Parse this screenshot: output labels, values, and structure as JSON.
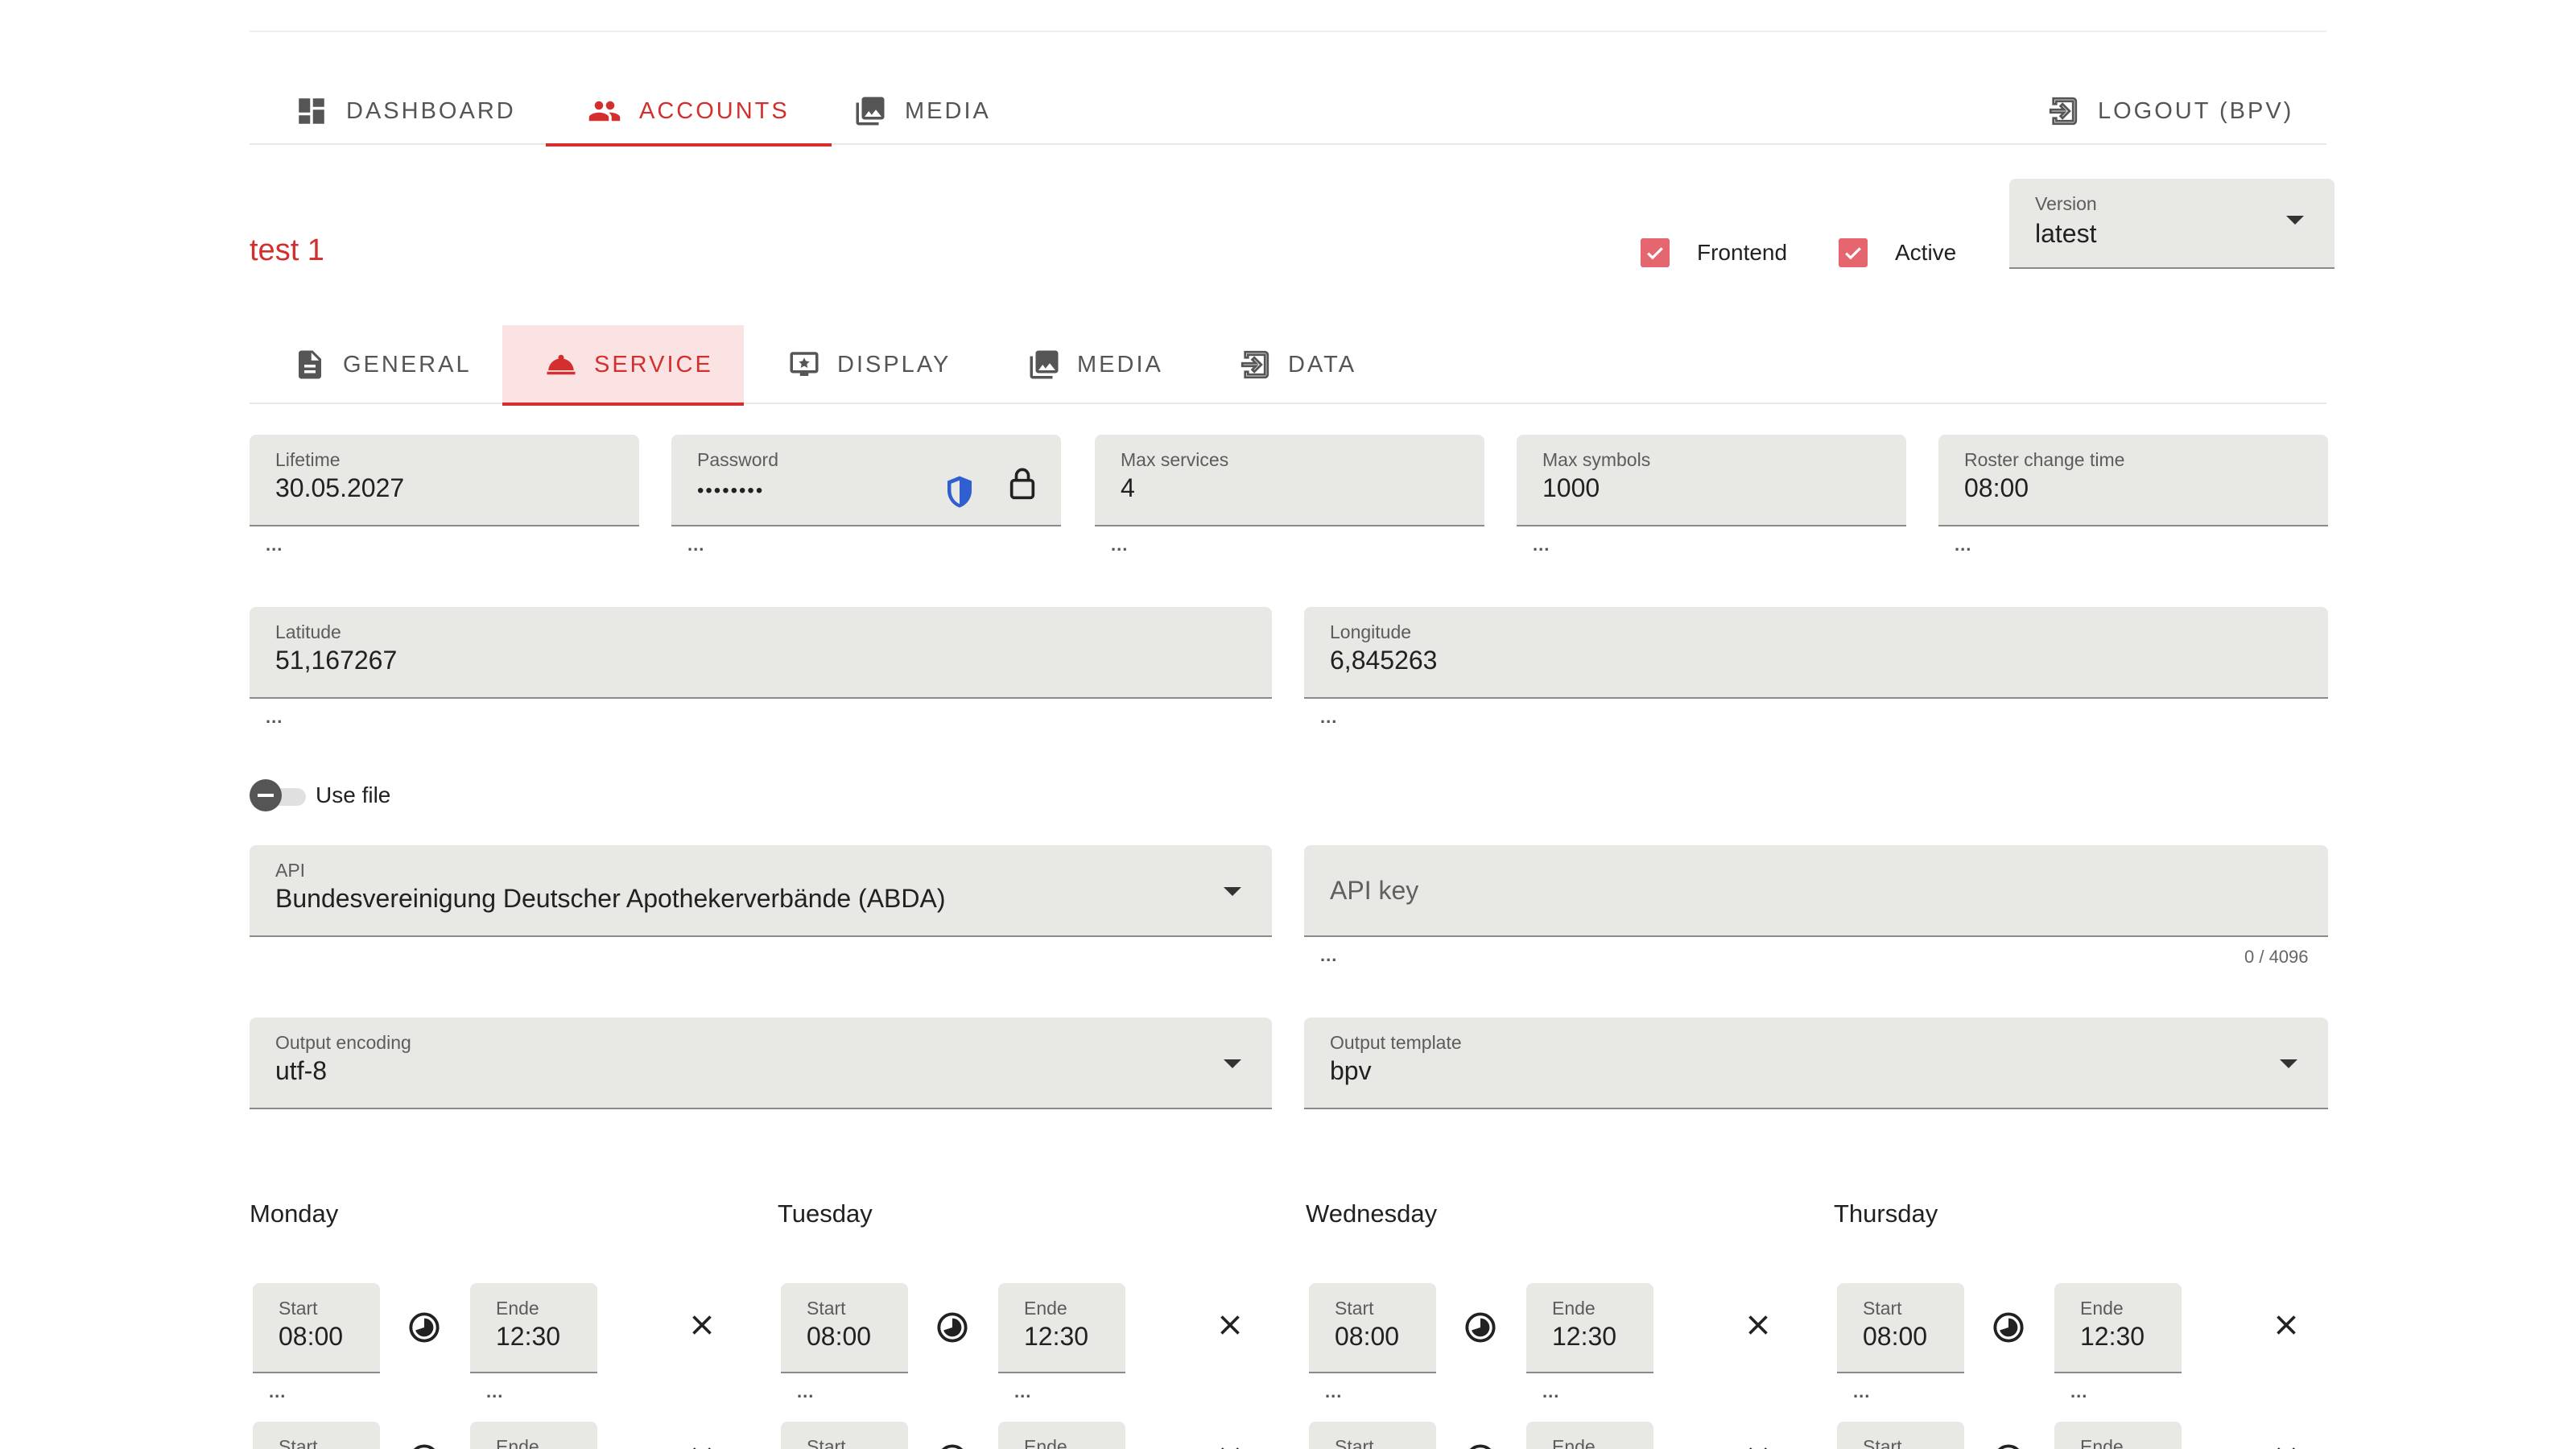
{
  "nav": {
    "dashboard": "DASHBOARD",
    "accounts": "ACCOUNTS",
    "media": "MEDIA",
    "logout": "LOGOUT (BPV)"
  },
  "account": {
    "title": "test 1",
    "frontend_label": "Frontend",
    "frontend_checked": true,
    "active_label": "Active",
    "active_checked": true,
    "version_label": "Version",
    "version_value": "latest"
  },
  "tabs": {
    "general": "GENERAL",
    "service": "SERVICE",
    "display": "DISPLAY",
    "media": "MEDIA",
    "data": "DATA"
  },
  "fields": {
    "lifetime": {
      "label": "Lifetime",
      "value": "30.05.2027"
    },
    "password": {
      "label": "Password",
      "value": "••••••••"
    },
    "max_services": {
      "label": "Max services",
      "value": "4"
    },
    "max_symbols": {
      "label": "Max symbols",
      "value": "1000"
    },
    "roster_change_time": {
      "label": "Roster change time",
      "value": "08:00"
    },
    "latitude": {
      "label": "Latitude",
      "value": "51,167267"
    },
    "longitude": {
      "label": "Longitude",
      "value": "6,845263"
    },
    "use_file": {
      "label": "Use file"
    },
    "api": {
      "label": "API",
      "value": "Bundesvereinigung Deutscher Apothekerverbände (ABDA)"
    },
    "api_key": {
      "placeholder": "API key",
      "counter": "0 / 4096"
    },
    "output_encoding": {
      "label": "Output encoding",
      "value": "utf-8"
    },
    "output_template": {
      "label": "Output template",
      "value": "bpv"
    }
  },
  "hint": "...",
  "days": [
    {
      "name": "Monday",
      "start_label": "Start",
      "start": "08:00",
      "end_label": "Ende",
      "end": "12:30",
      "next_start_label": "Start",
      "next_end_label": "Ende"
    },
    {
      "name": "Tuesday",
      "start_label": "Start",
      "start": "08:00",
      "end_label": "Ende",
      "end": "12:30",
      "next_start_label": "Start",
      "next_end_label": "Ende"
    },
    {
      "name": "Wednesday",
      "start_label": "Start",
      "start": "08:00",
      "end_label": "Ende",
      "end": "12:30",
      "next_start_label": "Start",
      "next_end_label": "Ende"
    },
    {
      "name": "Thursday",
      "start_label": "Start",
      "start": "08:00",
      "end_label": "Ende",
      "end": "12:30",
      "next_start_label": "Start",
      "next_end_label": "Ende"
    }
  ],
  "colors": {
    "accent": "#d32f2f",
    "checkbox": "#e5666f",
    "field_bg": "#e8e8e4",
    "shield": "#2f5fd0"
  }
}
